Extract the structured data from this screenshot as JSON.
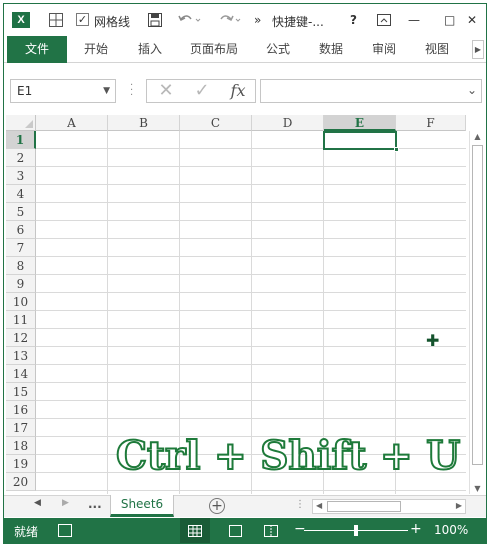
{
  "titlebar": {
    "app_icon_label": "X",
    "gridlines_label": "网格线",
    "gridlines_checked": true,
    "more_label": "»",
    "doc_title": "快捷键-...",
    "help_label": "?",
    "minimize_label": "—",
    "close_label": "✕"
  },
  "ribbon": {
    "tabs": [
      "文件",
      "开始",
      "插入",
      "页面布局",
      "公式",
      "数据",
      "审阅",
      "视图"
    ],
    "scroll_label": "▶"
  },
  "formula_bar": {
    "name_box": "E1",
    "cancel_label": "✕",
    "enter_label": "✓",
    "fx_label": "fx",
    "formula_value": ""
  },
  "grid": {
    "columns": [
      "A",
      "B",
      "C",
      "D",
      "E",
      "F"
    ],
    "rows": [
      "1",
      "2",
      "3",
      "4",
      "5",
      "6",
      "7",
      "8",
      "9",
      "10",
      "11",
      "12",
      "13",
      "14",
      "15",
      "16",
      "17",
      "18",
      "19",
      "20"
    ],
    "selected_column": "E",
    "selected_row": "1"
  },
  "overlay": {
    "shortcut": "Ctrl + Shift + U"
  },
  "sheets": {
    "nav_prev": "◀",
    "nav_next": "▶",
    "more": "...",
    "active_sheet": "Sheet6",
    "add_label": "+"
  },
  "status": {
    "ready": "就绪",
    "zoom_minus": "−",
    "zoom_plus": "+",
    "zoom": "100%"
  },
  "colors": {
    "accent": "#217346",
    "statusbar": "#217346"
  }
}
